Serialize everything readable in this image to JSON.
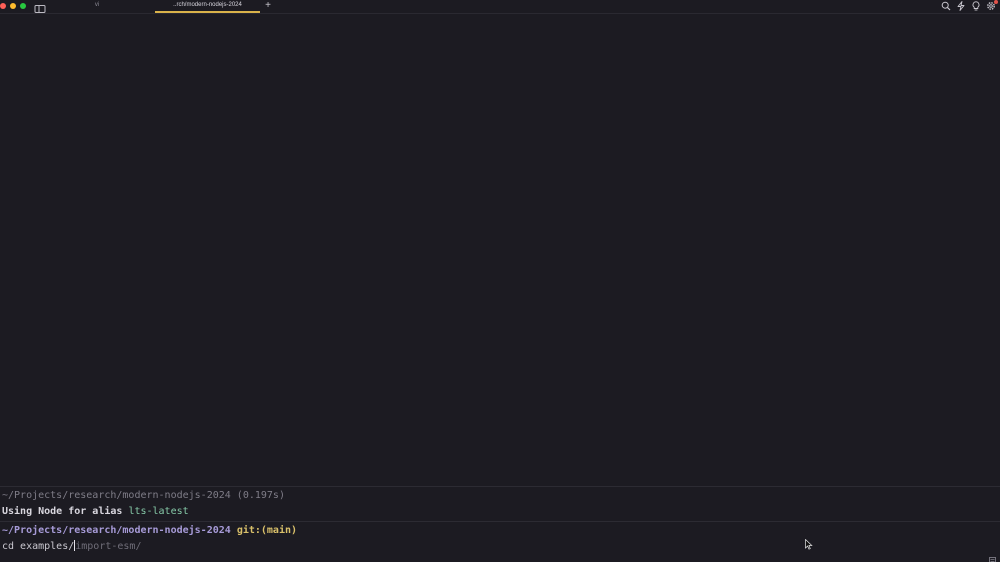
{
  "tabs": [
    {
      "label": "vi",
      "active": false
    },
    {
      "label": "..rch/modern-nodejs-2024",
      "active": true
    }
  ],
  "titlebar": {
    "new_tab_label": "+",
    "icons": [
      "search-icon",
      "bolt-icon",
      "lightbulb-icon",
      "settings-icon"
    ]
  },
  "terminal": {
    "previous_block": {
      "prompt": "~/Projects/research/modern-nodejs-2024 (0.197s)",
      "output_prefix": "Using Node for alias ",
      "output_alias": "lts-latest"
    },
    "current_prompt": {
      "path": "~/Projects/research/modern-nodejs-2024 ",
      "git": "git:(main)"
    },
    "input": {
      "typed": "cd examples/",
      "suggestion": "import-esm/"
    }
  },
  "colors": {
    "background": "#1c1b22",
    "active_tab_underline": "#d9b24a",
    "prompt": "#a79bd8",
    "git": "#d9c06a",
    "alias": "#86c9a8"
  }
}
